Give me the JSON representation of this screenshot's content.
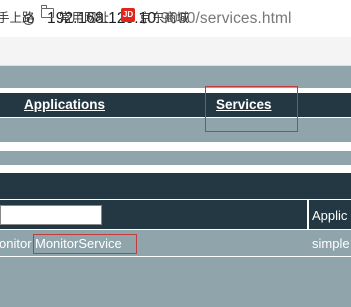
{
  "browser": {
    "url_host": "192.168.129.10",
    "url_port": ":9090",
    "url_path": "/services.html",
    "info_icon": "info-icon"
  },
  "bookmarks": {
    "partial_item": "手上路",
    "common_sites": "常用网址",
    "jd_icon_text": "JD",
    "jd_label": "京东商城"
  },
  "nav": {
    "applications": "Applications",
    "services": "Services"
  },
  "table": {
    "header_col2": "Applic",
    "row_col1_prefix": "onitor",
    "row_col1_service": "MonitorService",
    "row_col2": "simple"
  },
  "colors": {
    "navy": "#233842",
    "slate": "#8fa4ab",
    "annotation_red": "#c23c3c"
  }
}
